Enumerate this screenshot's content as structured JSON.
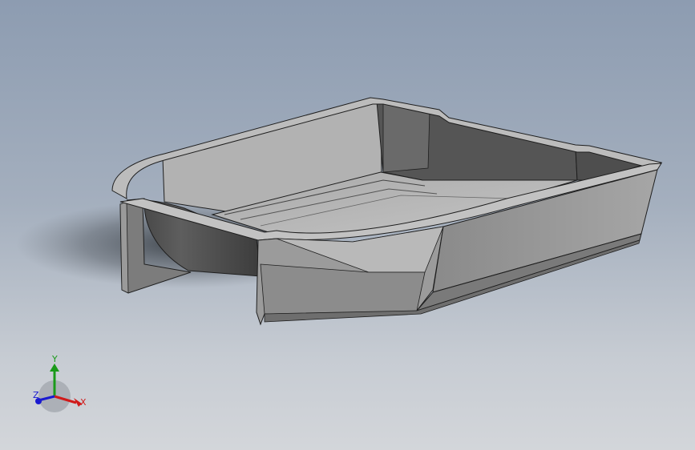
{
  "viewport": {
    "background_top": "#8d9cb1",
    "background_bottom": "#d3d6da"
  },
  "triad": {
    "x_label": "X",
    "y_label": "Y",
    "z_label": "Z",
    "x_color": "#d01a1a",
    "y_color": "#1a9a1a",
    "z_color": "#1a1ad0"
  }
}
